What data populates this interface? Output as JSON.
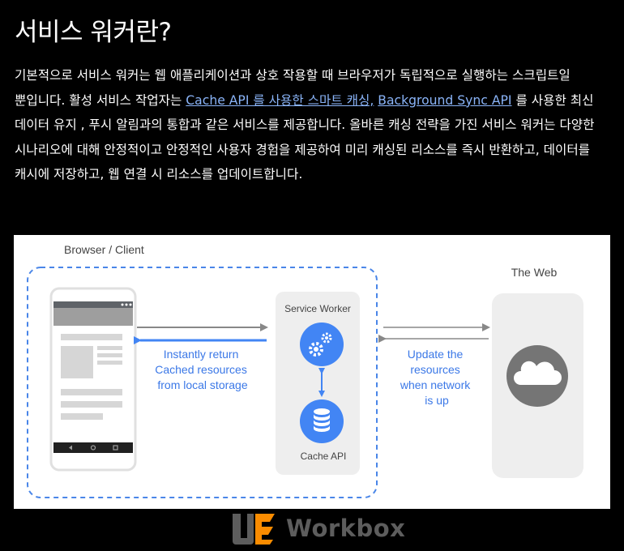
{
  "heading": "서비스 워커란?",
  "paragraph": {
    "text_before": "기본적으로 서비스 워커는 웹 애플리케이션과 상호 작용할 때 브라우저가 독립적으로 실행하는 스크립트일 뿐입니다. 활성 서비스 작업자는 ",
    "link1": "Cache API 를 사용한 스마트 캐싱,",
    "text_between": " ",
    "link2": "Background Sync API",
    "text_after": " 를 사용한 최신 데이터 유지 , 푸시 알림과의 통합과 같은 서비스를 제공합니다. 올바른 캐싱 전략을 가진 서비스 워커는 다양한 시나리오에 대해 안정적이고 안정적인 사용자 경험을 제공하여 미리 캐싱된 리소스를 즉시 반환하고, 데이터를 캐시에 저장하고, 웹 연결 시 리소스를 업데이트합니다."
  },
  "diagram": {
    "browser_label": "Browser / Client",
    "web_label": "The Web",
    "service_worker_label": "Service Worker",
    "cache_api_label": "Cache API",
    "left_caption": [
      "Instantly return",
      "Cached resources",
      "from local storage"
    ],
    "right_caption": [
      "Update the",
      "resources",
      "when network",
      "is up"
    ],
    "colors": {
      "accent_blue": "#4285f4",
      "caption_blue": "#3b78e7",
      "dashed_border": "#4a86e8",
      "panel_gray": "#eeeeee",
      "arrow_gray": "#888888",
      "cloud_circle": "#757575"
    },
    "icons": [
      "phone-mockup",
      "gears-icon",
      "database-icon",
      "cloud-icon"
    ]
  },
  "footer": {
    "logo_text": "Workbox",
    "logo_colors": {
      "orange": "#fb8c00",
      "dark": "#5d5d5d"
    }
  }
}
